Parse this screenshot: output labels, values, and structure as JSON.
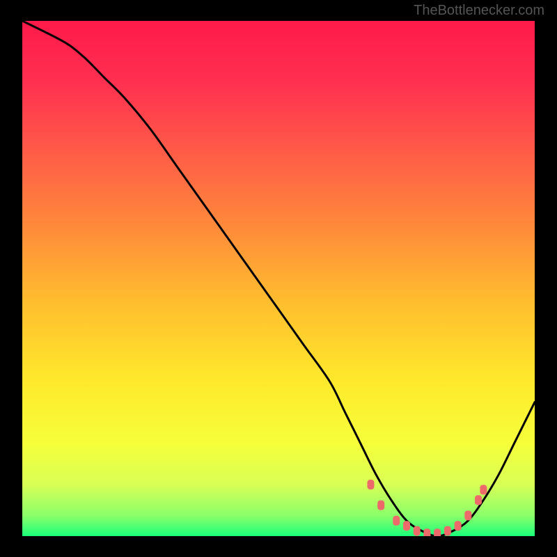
{
  "watermark": "TheBottlenecker.com",
  "chart_data": {
    "type": "line",
    "title": "",
    "xlabel": "",
    "ylabel": "",
    "xlim": [
      0,
      100
    ],
    "ylim": [
      0,
      100
    ],
    "gradient_stops": [
      {
        "offset": 0.0,
        "color": "#ff1a4a"
      },
      {
        "offset": 0.12,
        "color": "#ff3050"
      },
      {
        "offset": 0.25,
        "color": "#ff5a48"
      },
      {
        "offset": 0.4,
        "color": "#ff8a3a"
      },
      {
        "offset": 0.55,
        "color": "#ffbf2e"
      },
      {
        "offset": 0.7,
        "color": "#ffe92c"
      },
      {
        "offset": 0.82,
        "color": "#f6ff3a"
      },
      {
        "offset": 0.9,
        "color": "#d8ff55"
      },
      {
        "offset": 0.96,
        "color": "#8bff6a"
      },
      {
        "offset": 1.0,
        "color": "#1aff7a"
      }
    ],
    "series": [
      {
        "name": "bottleneck-curve",
        "color": "#000000",
        "x": [
          0,
          8,
          12,
          16,
          20,
          25,
          30,
          35,
          40,
          45,
          50,
          55,
          60,
          63,
          66,
          69,
          72,
          75,
          78,
          81,
          84,
          87,
          90,
          93,
          96,
          100
        ],
        "y": [
          100,
          96,
          93,
          89,
          85,
          79,
          72,
          65,
          58,
          51,
          44,
          37,
          30,
          24,
          18,
          12,
          7,
          3,
          1,
          0,
          1,
          3,
          7,
          12,
          18,
          26
        ]
      }
    ],
    "markers": {
      "name": "highlight-points",
      "color": "#ed6a6a",
      "x": [
        68,
        70,
        73,
        75,
        77,
        79,
        81,
        83,
        85,
        87,
        89,
        90
      ],
      "y": [
        10,
        6,
        3,
        2,
        1,
        0.5,
        0.5,
        1,
        2,
        4,
        7,
        9
      ]
    }
  }
}
